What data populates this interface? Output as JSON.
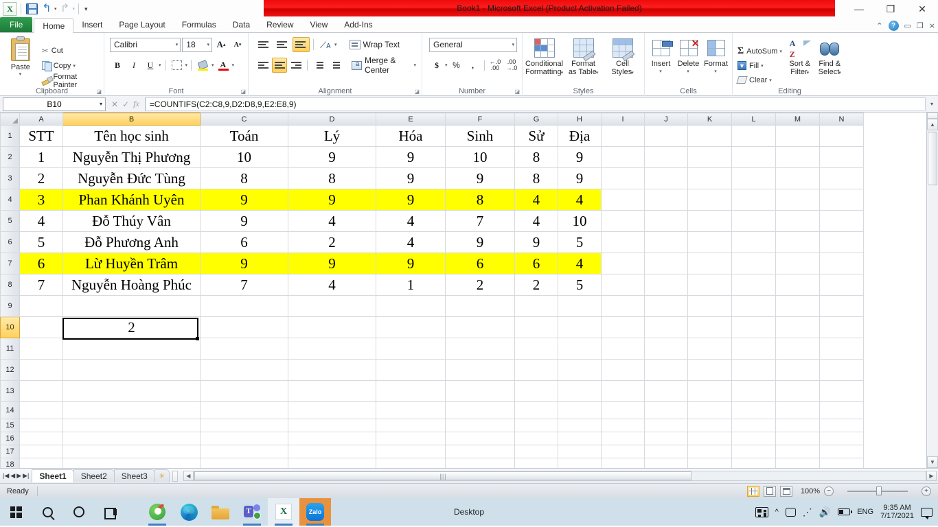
{
  "window": {
    "title": "Book1  -  Microsoft Excel (Product Activation Failed)",
    "minimize": "—",
    "restore": "❐",
    "close": "✕"
  },
  "quick_access": {
    "excel_logo": "X",
    "save": "save-icon",
    "undo": "↺",
    "redo": "↻",
    "customize": "▾"
  },
  "ribbon": {
    "tabs": [
      {
        "label": "File",
        "active": false
      },
      {
        "label": "Home",
        "active": true
      },
      {
        "label": "Insert",
        "active": false
      },
      {
        "label": "Page Layout",
        "active": false
      },
      {
        "label": "Formulas",
        "active": false
      },
      {
        "label": "Data",
        "active": false
      },
      {
        "label": "Review",
        "active": false
      },
      {
        "label": "View",
        "active": false
      },
      {
        "label": "Add-Ins",
        "active": false
      }
    ],
    "help": "?",
    "groups": {
      "clipboard": {
        "label": "Clipboard",
        "paste": "Paste",
        "cut": "Cut",
        "copy": "Copy",
        "format_painter": "Format Painter"
      },
      "font": {
        "label": "Font",
        "font_name": "Calibri",
        "font_size": "18",
        "grow": "A",
        "shrink": "A",
        "bold": "B",
        "italic": "I",
        "underline": "U",
        "borders": "borders-icon",
        "fill_color": "fill-color-icon",
        "font_color": "A"
      },
      "alignment": {
        "label": "Alignment",
        "top_align": "top-align-icon",
        "middle_align": "middle-align-icon",
        "bottom_align": "bottom-align-icon",
        "orientation": "orientation-icon",
        "align_left": "align-left-icon",
        "align_center": "align-center-icon",
        "align_right": "align-right-icon",
        "decrease_indent": "decrease-indent-icon",
        "increase_indent": "increase-indent-icon",
        "wrap_text": "Wrap Text",
        "merge_center": "Merge & Center"
      },
      "number": {
        "label": "Number",
        "format": "General",
        "currency": "$",
        "percent": "%",
        "comma": ",",
        "increase_decimal": ".00",
        "decrease_decimal": ".00"
      },
      "styles": {
        "label": "Styles",
        "conditional_formatting": "Conditional\nFormatting",
        "conditional_formatting_l1": "Conditional",
        "conditional_formatting_l2": "Formatting",
        "format_as_table_l1": "Format",
        "format_as_table_l2": "as Table",
        "cell_styles_l1": "Cell",
        "cell_styles_l2": "Styles"
      },
      "cells": {
        "label": "Cells",
        "insert": "Insert",
        "delete": "Delete",
        "format": "Format"
      },
      "editing": {
        "label": "Editing",
        "autosum": "AutoSum",
        "fill": "Fill",
        "clear": "Clear",
        "sort_filter_l1": "Sort &",
        "sort_filter_l2": "Filter",
        "find_select_l1": "Find &",
        "find_select_l2": "Select"
      }
    }
  },
  "formula_bar": {
    "name_box": "B10",
    "cancel": "✕",
    "enter": "✓",
    "fx": "fx",
    "formula": "=COUNTIFS(C2:C8,9,D2:D8,9,E2:E8,9)"
  },
  "sheet": {
    "column_headers": [
      "A",
      "B",
      "C",
      "D",
      "E",
      "F",
      "G",
      "H",
      "I",
      "J",
      "K",
      "L",
      "M",
      "N"
    ],
    "selected_column": "B",
    "selected_row": 10,
    "row_numbers": [
      1,
      2,
      3,
      4,
      5,
      6,
      7,
      8,
      9,
      10,
      11,
      12,
      13,
      14,
      15,
      16,
      17,
      18
    ],
    "rows": [
      {
        "n": 1,
        "highlight": false,
        "cells": [
          "STT",
          "Tên học sinh",
          "Toán",
          "Lý",
          "Hóa",
          "Sinh",
          "Sử",
          "Địa"
        ]
      },
      {
        "n": 2,
        "highlight": false,
        "cells": [
          "1",
          "Nguyễn Thị Phương",
          "10",
          "9",
          "9",
          "10",
          "8",
          "9"
        ]
      },
      {
        "n": 3,
        "highlight": false,
        "cells": [
          "2",
          "Nguyễn Đức Tùng",
          "8",
          "8",
          "9",
          "9",
          "8",
          "9"
        ]
      },
      {
        "n": 4,
        "highlight": true,
        "cells": [
          "3",
          "Phan Khánh Uyên",
          "9",
          "9",
          "9",
          "8",
          "4",
          "4"
        ]
      },
      {
        "n": 5,
        "highlight": false,
        "cells": [
          "4",
          "Đỗ Thúy Vân",
          "9",
          "4",
          "4",
          "7",
          "4",
          "10"
        ]
      },
      {
        "n": 6,
        "highlight": false,
        "cells": [
          "5",
          "Đỗ Phương Anh",
          "6",
          "2",
          "4",
          "9",
          "9",
          "5"
        ]
      },
      {
        "n": 7,
        "highlight": true,
        "cells": [
          "6",
          "Lừ Huyền Trâm",
          "9",
          "9",
          "9",
          "6",
          "6",
          "4"
        ]
      },
      {
        "n": 8,
        "highlight": false,
        "cells": [
          "7",
          "Nguyễn Hoàng Phúc",
          "7",
          "4",
          "1",
          "2",
          "2",
          "5"
        ]
      },
      {
        "n": 9,
        "highlight": false,
        "cells": [
          "",
          "",
          "",
          "",
          "",
          "",
          "",
          ""
        ]
      },
      {
        "n": 10,
        "highlight": false,
        "cells": [
          "",
          "2",
          "",
          "",
          "",
          "",
          "",
          ""
        ]
      },
      {
        "n": 11,
        "highlight": false,
        "cells": [
          "",
          "",
          "",
          "",
          "",
          "",
          "",
          ""
        ]
      },
      {
        "n": 12,
        "highlight": false,
        "cells": [
          "",
          "",
          "",
          "",
          "",
          "",
          "",
          ""
        ]
      },
      {
        "n": 13,
        "highlight": false,
        "cells": [
          "",
          "",
          "",
          "",
          "",
          "",
          "",
          ""
        ]
      },
      {
        "n": 14,
        "highlight": false,
        "cells": [
          "",
          "",
          "",
          "",
          "",
          "",
          "",
          ""
        ]
      },
      {
        "n": 15,
        "highlight": false,
        "cells": [
          "",
          "",
          "",
          "",
          "",
          "",
          "",
          ""
        ]
      },
      {
        "n": 16,
        "highlight": false,
        "cells": [
          "",
          "",
          "",
          "",
          "",
          "",
          "",
          ""
        ]
      },
      {
        "n": 17,
        "highlight": false,
        "cells": [
          "",
          "",
          "",
          "",
          "",
          "",
          "",
          ""
        ]
      },
      {
        "n": 18,
        "highlight": false,
        "cells": [
          "",
          "",
          "",
          "",
          "",
          "",
          "",
          ""
        ]
      }
    ],
    "highlight_color": "#ffff00",
    "selected_cell_value": "2"
  },
  "sheet_tabs": {
    "first": "◀◀",
    "prev": "◀",
    "next": "▶",
    "last": "▶▶",
    "tabs": [
      {
        "label": "Sheet1",
        "active": true
      },
      {
        "label": "Sheet2",
        "active": false
      },
      {
        "label": "Sheet3",
        "active": false
      }
    ],
    "new_sheet": "✷"
  },
  "status_bar": {
    "state": "Ready",
    "view_normal": "normal-view-icon",
    "view_page_layout": "page-layout-view-icon",
    "view_page_break": "page-break-view-icon",
    "zoom": "100%",
    "zoom_out": "−",
    "zoom_in": "+"
  },
  "taskbar": {
    "start": "start-icon",
    "search": "search-icon",
    "cortana": "cortana-icon",
    "task_view": "task-view-icon",
    "apps": [
      {
        "name": "green-app-icon"
      },
      {
        "name": "microsoft-edge-icon"
      },
      {
        "name": "file-explorer-icon"
      },
      {
        "name": "microsoft-teams-icon"
      },
      {
        "name": "microsoft-excel-icon"
      },
      {
        "name": "zalo-icon"
      }
    ],
    "excel_label": "X",
    "zalo_label": "Zalo",
    "desktop_label": "Desktop",
    "tray": {
      "news": "news-icon",
      "show_hidden": "^",
      "camera": "camera-icon",
      "network": "network-icon",
      "volume": "volume-icon",
      "battery": "battery-icon",
      "language": "ENG",
      "time": "9:35 AM",
      "date": "7/17/2021",
      "action_center": "chat-icon"
    }
  }
}
